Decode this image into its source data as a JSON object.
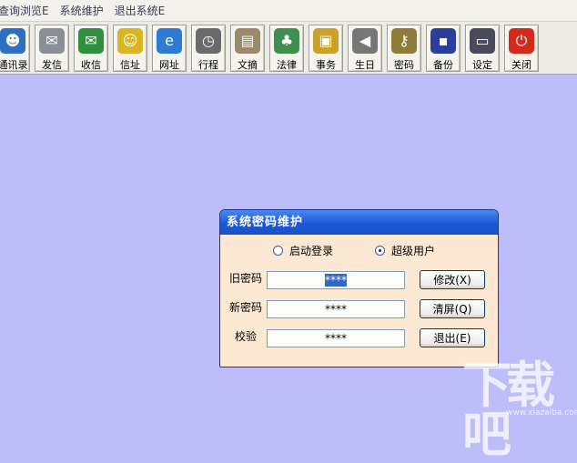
{
  "menu": [
    "查询浏览E",
    "系统维护",
    "退出系统E"
  ],
  "toolbar": [
    {
      "label": "通讯录",
      "icon": "contacts-icon",
      "glyph": "☻",
      "color": "#2f6fbf"
    },
    {
      "label": "发信",
      "icon": "send-mail-icon",
      "glyph": "✉",
      "color": "#8a8f95"
    },
    {
      "label": "收信",
      "icon": "inbox-icon",
      "glyph": "✉",
      "color": "#2f8f3f"
    },
    {
      "label": "信址",
      "icon": "address-book-icon",
      "glyph": "☺",
      "color": "#d8b820"
    },
    {
      "label": "网址",
      "icon": "internet-explorer-icon",
      "glyph": "e",
      "color": "#2e7bd6"
    },
    {
      "label": "行程",
      "icon": "clock-icon",
      "glyph": "◷",
      "color": "#6a6a6a"
    },
    {
      "label": "文摘",
      "icon": "notebook-icon",
      "glyph": "▤",
      "color": "#9a8a6a"
    },
    {
      "label": "法律",
      "icon": "law-book-icon",
      "glyph": "♣",
      "color": "#3f8f4f"
    },
    {
      "label": "事务",
      "icon": "certificate-icon",
      "glyph": "▣",
      "color": "#c9a227"
    },
    {
      "label": "生日",
      "icon": "speaker-icon",
      "glyph": "◀",
      "color": "#777777"
    },
    {
      "label": "密码",
      "icon": "keys-icon",
      "glyph": "⚷",
      "color": "#8f7a3a"
    },
    {
      "label": "备份",
      "icon": "floppy-disk-icon",
      "glyph": "▪",
      "color": "#2a3f9a"
    },
    {
      "label": "设定",
      "icon": "settings-monitor-icon",
      "glyph": "▭",
      "color": "#4a4a5a"
    },
    {
      "label": "关闭",
      "icon": "power-icon",
      "glyph": "⏻",
      "color": "#d42a1a"
    }
  ],
  "dialog": {
    "title": "系统密码维护",
    "radio_startup": "启动登录",
    "radio_superuser": "超级用户",
    "old_password_label": "旧密码",
    "new_password_label": "新密码",
    "verify_label": "校验",
    "old_password_value": "****",
    "new_password_value": "****",
    "verify_value": "****",
    "modify_button": "修改(X)",
    "clear_button": "清屏(Q)",
    "exit_button": "退出(E)"
  },
  "watermark": {
    "text": "下载吧",
    "sub": "www.xiazaiba.com"
  }
}
